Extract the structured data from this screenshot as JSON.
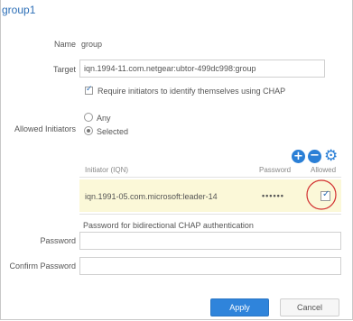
{
  "title": "group1",
  "form": {
    "name_label": "Name",
    "name_value": "group",
    "target_label": "Target",
    "target_value": "iqn.1994-11.com.netgear:ubtor-499dc998:group",
    "chap_checkbox_label": "Require initiators to identify themselves using CHAP",
    "allowed_initiators_label": "Allowed Initiators",
    "radio_any_label": "Any",
    "radio_selected_label": "Selected"
  },
  "table": {
    "headers": [
      "Initiator (IQN)",
      "Password",
      "Allowed"
    ],
    "rows": [
      {
        "iqn": "iqn.1991-05.com.microsoft:leader-14",
        "password": "••••••",
        "allowed": "✓"
      }
    ]
  },
  "password_section": {
    "note": "Password for bidirectional CHAP authentication",
    "password_label": "Password",
    "confirm_password_label": "Confirm Password"
  },
  "buttons": {
    "apply": "Apply",
    "cancel": "Cancel"
  },
  "icons": {
    "add": "+",
    "remove": "−",
    "settings": "⚙"
  },
  "colors": {
    "accent": "#2f84db",
    "row_highlight": "#fbf8d8",
    "circle": "#d23030"
  }
}
